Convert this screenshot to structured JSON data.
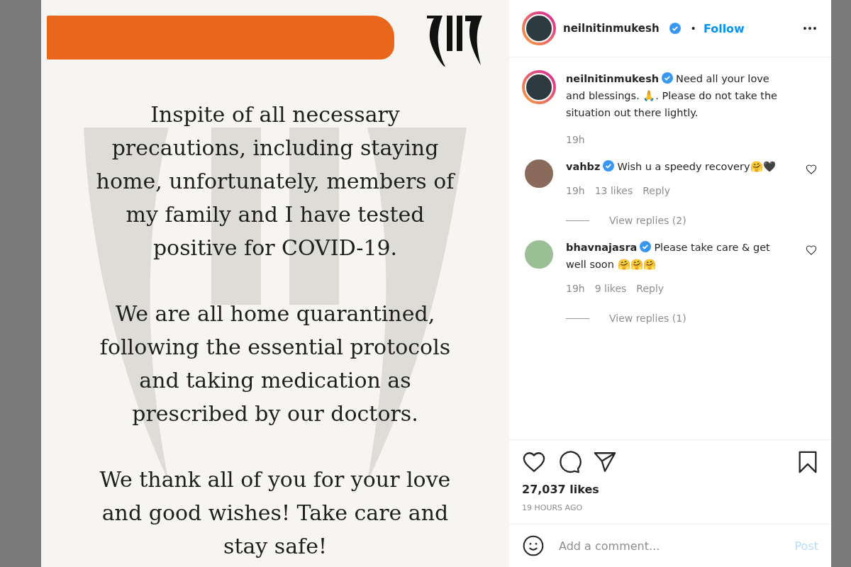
{
  "post_image": {
    "paragraphs": [
      "Inspite of all necessary precautions, including staying home, unfortunately, members of my family and I have tested positive for COVID-19.",
      "We are all home quarantined, following the essential protocols and taking medication as prescribed by our doctors.",
      "We thank all of you for your love and good wishes! Take care and stay safe!"
    ]
  },
  "header": {
    "username": "neilnitinmukesh",
    "verified": true,
    "separator": "•",
    "follow": "Follow"
  },
  "caption": {
    "username": "neilnitinmukesh",
    "verified": true,
    "text": "Need all your love and blessings. 🙏. Please do not take the situation out there lightly.",
    "time": "19h"
  },
  "comments": [
    {
      "username": "vahbz",
      "verified": true,
      "text": "Wish u a speedy recovery🤗🖤",
      "time": "19h",
      "likes": "13 likes",
      "reply": "Reply",
      "view_replies": "View replies (2)",
      "liked": false
    },
    {
      "username": "bhavnajasra",
      "verified": true,
      "text": "Please take care & get well soon 🤗🤗🤗",
      "time": "19h",
      "likes": "9 likes",
      "reply": "Reply",
      "view_replies": "View replies (1)",
      "liked": false
    }
  ],
  "likes": "27,037 likes",
  "posted": "19 HOURS AGO",
  "saved": false,
  "comment_box": {
    "placeholder": "Add a comment...",
    "post": "Post"
  }
}
